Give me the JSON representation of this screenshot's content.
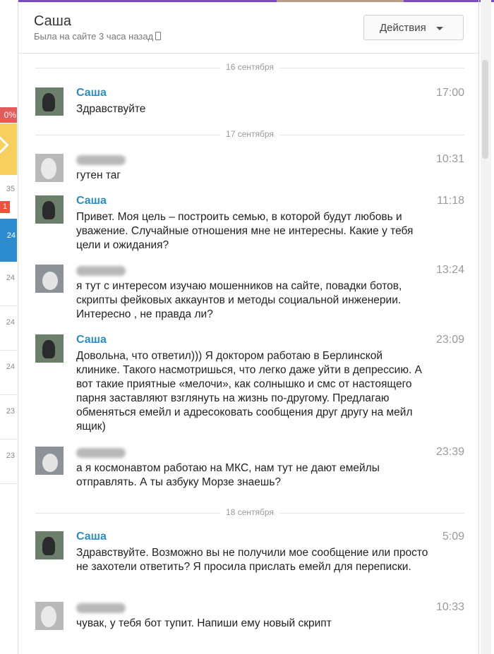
{
  "header": {
    "name": "Саша",
    "status": "Была на сайте 3 часа назад",
    "actions_label": "Действия"
  },
  "sidebar": {
    "badge_percent": "0%",
    "count_label": "35",
    "count_badge": "1",
    "row_labels": [
      "24",
      "24",
      "24",
      "24",
      "23",
      "23"
    ]
  },
  "chat": {
    "dates": [
      "16 сентября",
      "17 сентября",
      "18 сентября"
    ],
    "messages": [
      {
        "sender": "Саша",
        "time": "17:00",
        "text": "Здравствуйте"
      },
      {
        "sender": "",
        "time": "10:31",
        "text": "гутен таг"
      },
      {
        "sender": "Саша",
        "time": "11:18",
        "text": "Привет. Моя цель – построить семью, в которой будут любовь и уважение. Случайные отношения мне не интересны. Какие у тебя цели и ожидания?"
      },
      {
        "sender": "",
        "time": "13:24",
        "text": "я тут с интересом изучаю мошенников на сайте, повадки ботов, скрипты фейковых аккаунтов и методы социальной инженерии. Интересно , не правда ли?"
      },
      {
        "sender": "Саша",
        "time": "23:09",
        "text": "Довольна, что ответил))) Я доктором работаю в Берлинской клинике. Такого насмотришься, что легко даже уйти в депрессию. А вот такие приятные «мелочи», как солнышко и смс от настоящего парня заставляют взглянуть на жизнь по-другому. Предлагаю обменяться емейл и адресоковать сообщения друг другу на мейл ящик)"
      },
      {
        "sender": "",
        "time": "23:39",
        "text": "а я космонавтом работаю на МКС, нам тут не дают емейлы отправлять. А ты азбуку Морзе знаешь?"
      },
      {
        "sender": "Саша",
        "time": "5:09",
        "text": "Здравствуйте. Возможно вы не получили мое сообщение или просто не захотели ответить? Я просила прислать емейл для переписки."
      },
      {
        "sender": "",
        "time": "10:33",
        "text": "чувак, у тебя бот тупит. Напиши ему новый скрипт"
      }
    ]
  }
}
